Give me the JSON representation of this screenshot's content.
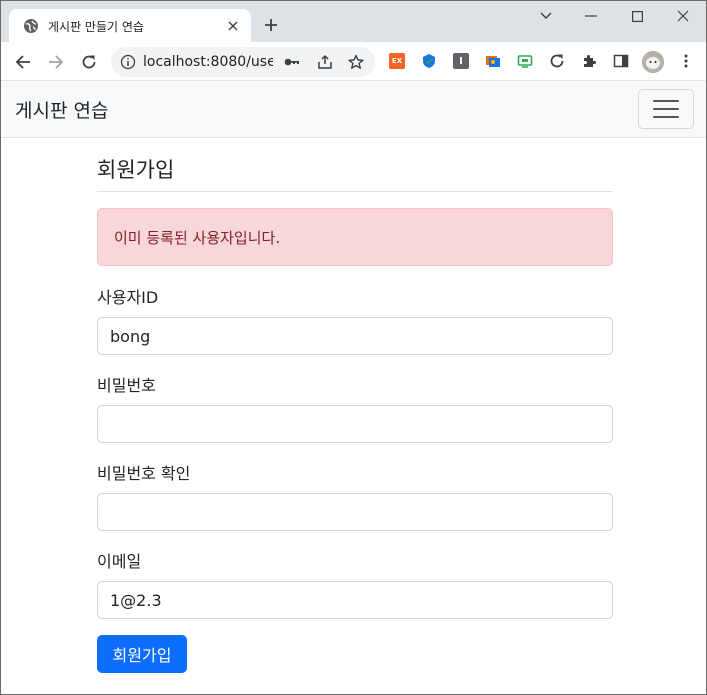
{
  "browser": {
    "tab_title": "게시판 만들기 연습",
    "url": "localhost:8080/use...",
    "extensions": [
      {
        "name": "ex-extension",
        "label": "EX",
        "color": "#f26522"
      },
      {
        "name": "shield-extension",
        "label": "",
        "color": "#1a73e8"
      },
      {
        "name": "reader-extension",
        "label": "I",
        "color": "#5f6368"
      },
      {
        "name": "gallery-extension",
        "label": "",
        "color": "#e8710a"
      },
      {
        "name": "screen-extension",
        "label": "",
        "color": "#34a853"
      }
    ]
  },
  "navbar": {
    "brand": "게시판 연습"
  },
  "form": {
    "title": "회원가입",
    "alert": "이미 등록된 사용자입니다.",
    "fields": {
      "username": {
        "label": "사용자ID",
        "value": "bong"
      },
      "password": {
        "label": "비밀번호",
        "value": ""
      },
      "password_confirm": {
        "label": "비밀번호 확인",
        "value": ""
      },
      "email": {
        "label": "이메일",
        "value": "1@2.3"
      }
    },
    "submit": "회원가입"
  },
  "colors": {
    "primary": "#0d6efd",
    "alert_bg": "#f8d7da",
    "alert_text": "#842029"
  }
}
